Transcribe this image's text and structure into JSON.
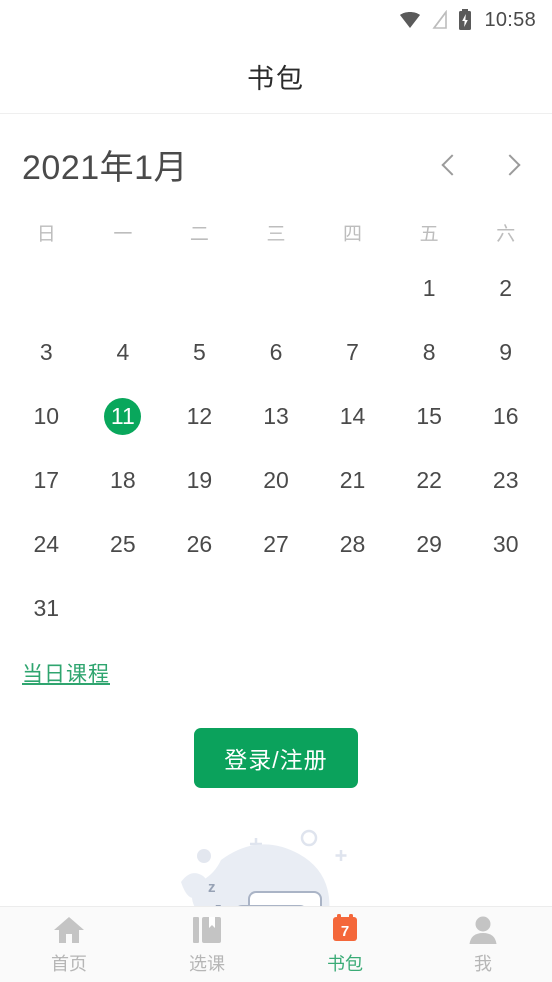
{
  "statusbar": {
    "time": "10:58",
    "icons": [
      "wifi-icon",
      "signal-off-icon",
      "battery-charging-icon"
    ]
  },
  "header": {
    "title": "书包"
  },
  "calendar": {
    "month_label": "2021年1月",
    "prev_label": "‹",
    "next_label": "›",
    "weekdays": [
      "日",
      "一",
      "二",
      "三",
      "四",
      "五",
      "六"
    ],
    "weeks": [
      [
        "",
        "",
        "",
        "",
        "",
        "1",
        "2"
      ],
      [
        "3",
        "4",
        "5",
        "6",
        "7",
        "8",
        "9"
      ],
      [
        "10",
        "11",
        "12",
        "13",
        "14",
        "15",
        "16"
      ],
      [
        "17",
        "18",
        "19",
        "20",
        "21",
        "22",
        "23"
      ],
      [
        "24",
        "25",
        "26",
        "27",
        "28",
        "29",
        "30"
      ],
      [
        "31",
        "",
        "",
        "",
        "",
        "",
        ""
      ]
    ],
    "selected_day": "11",
    "accent_color": "#09a75c"
  },
  "content": {
    "today_courses_label": "当日课程",
    "login_button_label": "登录/注册",
    "empty_illustration": "sleeping-empty-state-illustration"
  },
  "bottomnav": {
    "items": [
      {
        "label": "首页",
        "icon": "home-icon",
        "active": false
      },
      {
        "label": "选课",
        "icon": "book-bookmark-icon",
        "active": false
      },
      {
        "label": "书包",
        "icon": "calendar-icon",
        "badge": "7",
        "active": true
      },
      {
        "label": "我",
        "icon": "person-icon",
        "active": false
      }
    ],
    "active_color": "#3aab76",
    "inactive_color": "#b6b6b6",
    "calendar_icon_color": "#f4673a"
  }
}
